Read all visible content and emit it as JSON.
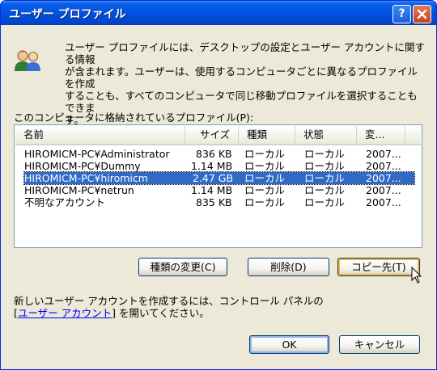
{
  "window": {
    "title": "ユーザー プロファイル",
    "help_label": "?"
  },
  "description": {
    "line1": "ユーザー プロファイルには、デスクトップの設定とユーザー アカウントに関する情報",
    "line2": "が含まれます。ユーザーは、使用するコンピュータごとに異なるプロファイルを作成",
    "line3": "することも、すべてのコンピュータで同じ移動プロファイルを選択することもできま",
    "line4": "す。"
  },
  "list_label": "このコンピュータに格納されているプロファイル(P):",
  "columns": {
    "name": "名前",
    "size": "サイズ",
    "type": "種類",
    "status": "状態",
    "modified": "変..."
  },
  "profiles": [
    {
      "name": "HIROMICM-PC¥Administrator",
      "size": "836 KB",
      "type": "ローカル",
      "status": "ローカル",
      "modified": "2007..."
    },
    {
      "name": "HIROMICM-PC¥Dummy",
      "size": "1.14 MB",
      "type": "ローカル",
      "status": "ローカル",
      "modified": "2007..."
    },
    {
      "name": "HIROMICM-PC¥hiromicm",
      "size": "2.47 GB",
      "type": "ローカル",
      "status": "ローカル",
      "modified": "2007...",
      "selected": true
    },
    {
      "name": "HIROMICM-PC¥netrun",
      "size": "1.14 MB",
      "type": "ローカル",
      "status": "ローカル",
      "modified": "2007..."
    },
    {
      "name": "不明なアカウント",
      "size": "835 KB",
      "type": "ローカル",
      "status": "ローカル",
      "modified": "2007..."
    }
  ],
  "buttons": {
    "change_type": "種類の変更(C)",
    "delete": "削除(D)",
    "copy_to": "コピー先(T)",
    "ok": "OK",
    "cancel": "キャンセル"
  },
  "note": {
    "line1": "新しいユーザー アカウントを作成するには、コントロール パネルの",
    "bracket_open": "[",
    "link": "ユーザー アカウント",
    "line2_rest": "] を開いてください。"
  },
  "icons": {
    "title_close": "close-icon",
    "profile": "users-icon",
    "cursor": "mouse-pointer-icon"
  }
}
